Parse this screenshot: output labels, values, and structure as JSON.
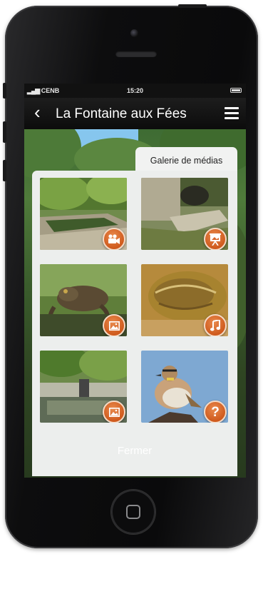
{
  "status_bar": {
    "carrier": "CENB",
    "time": "15:20"
  },
  "nav": {
    "title": "La Fontaine aux Fées"
  },
  "gallery": {
    "tab_label": "Galerie de médias",
    "items": [
      {
        "name": "Fountain basin",
        "type_icon": "video-icon"
      },
      {
        "name": "Stone fountain channel",
        "type_icon": "slideshow-icon"
      },
      {
        "name": "Toad",
        "type_icon": "image-icon"
      },
      {
        "name": "Frog",
        "type_icon": "music-icon"
      },
      {
        "name": "Fountain wall",
        "type_icon": "image-icon"
      },
      {
        "name": "Horned lark",
        "type_icon": "question-icon"
      }
    ],
    "close_label": "Fermer"
  },
  "colors": {
    "badge": "#d8652a",
    "panel": "#eceeed",
    "navbar": "#141414"
  }
}
